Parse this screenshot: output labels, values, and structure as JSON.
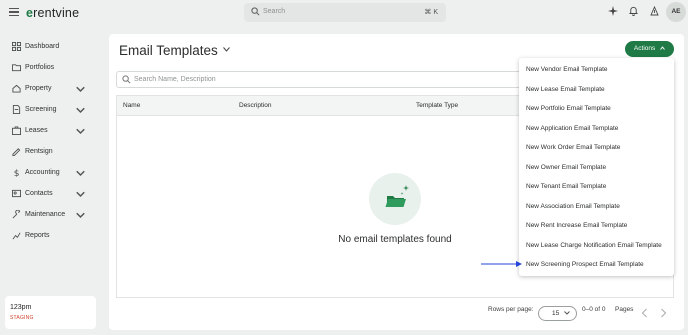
{
  "app": {
    "logo_prefix": "e",
    "logo_rest": "rentvine"
  },
  "topbar": {
    "search_placeholder": "Search",
    "search_shortcut": "⌘ K",
    "avatar_initials": "AE"
  },
  "sidebar": {
    "items": [
      {
        "label": "Dashboard",
        "icon": "dashboard-icon",
        "expandable": false
      },
      {
        "label": "Portfolios",
        "icon": "folder-icon",
        "expandable": false
      },
      {
        "label": "Property",
        "icon": "home-icon",
        "expandable": true
      },
      {
        "label": "Screening",
        "icon": "document-icon",
        "expandable": true
      },
      {
        "label": "Leases",
        "icon": "briefcase-icon",
        "expandable": true
      },
      {
        "label": "Rentsign",
        "icon": "signature-icon",
        "expandable": false
      },
      {
        "label": "Accounting",
        "icon": "dollar-icon",
        "expandable": true
      },
      {
        "label": "Contacts",
        "icon": "contacts-icon",
        "expandable": true
      },
      {
        "label": "Maintenance",
        "icon": "wrench-icon",
        "expandable": true
      },
      {
        "label": "Reports",
        "icon": "chart-icon",
        "expandable": false
      }
    ],
    "org": {
      "name": "123pm",
      "environment": "STAGING"
    }
  },
  "main": {
    "title": "Email Templates",
    "actions_label": "Actions",
    "search_placeholder": "Search Name, Description",
    "columns": [
      "Name",
      "Description",
      "Template Type"
    ],
    "empty_message": "No email templates found",
    "pagination": {
      "rows_label": "Rows per page:",
      "rows_value": "15",
      "range": "0–0 of 0",
      "pages_label": "Pages"
    }
  },
  "actions_menu": {
    "items": [
      "New Vendor Email Template",
      "New Lease Email Template",
      "New Portfolio Email Template",
      "New Application Email Template",
      "New Work Order Email Template",
      "New Owner Email Template",
      "New Tenant Email Template",
      "New Association Email Template",
      "New Rent Increase Email Template",
      "New Lease Charge Notification Email Template",
      "New Screening Prospect Email Template"
    ]
  },
  "colors": {
    "brand": "#1f7a45",
    "staging": "#d0402b",
    "arrow": "#2346d8"
  }
}
